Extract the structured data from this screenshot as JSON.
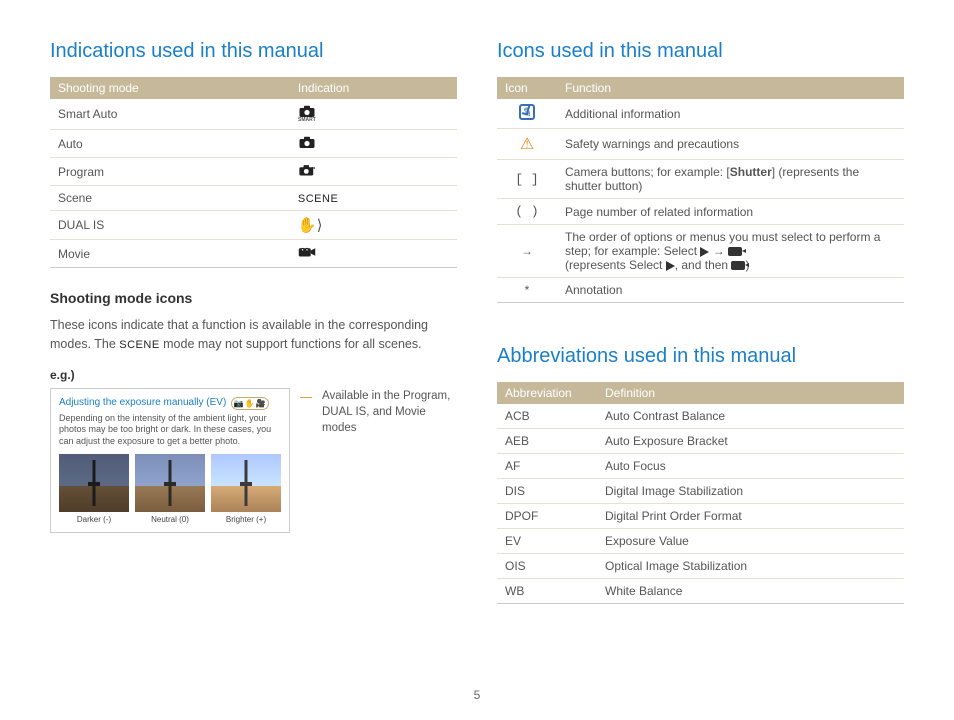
{
  "page_number": "5",
  "left": {
    "heading": "Indications used in this manual",
    "table_headers": {
      "col1": "Shooting mode",
      "col2": "Indication"
    },
    "modes": [
      {
        "name": "Smart Auto",
        "icon": "smart-auto-icon"
      },
      {
        "name": "Auto",
        "icon": "auto-camera-icon"
      },
      {
        "name": "Program",
        "icon": "program-camera-icon"
      },
      {
        "name": "Scene",
        "icon": "scene-icon"
      },
      {
        "name": "DUAL IS",
        "icon": "dual-is-icon"
      },
      {
        "name": "Movie",
        "icon": "movie-icon"
      }
    ],
    "subhead": "Shooting mode icons",
    "body_pre": "These icons indicate that a function is available in the corresponding modes. The ",
    "body_scene": "SCENE",
    "body_post": " mode may not support functions for all scenes.",
    "eg_label": "e.g.)",
    "example": {
      "title": "Adjusting the exposure manually (EV)",
      "desc": "Depending on the intensity of the ambient light, your photos may be too bright or dark. In these cases, you can adjust the exposure to get a better photo.",
      "thumbs": [
        {
          "label": "Darker (-)"
        },
        {
          "label": "Neutral (0)"
        },
        {
          "label": "Brighter (+)"
        }
      ]
    },
    "example_caption": "Available in the Program, DUAL IS, and Movie modes"
  },
  "right": {
    "heading1": "Icons used in this manual",
    "icons_headers": {
      "col1": "Icon",
      "col2": "Function"
    },
    "icons": [
      {
        "sym": "info",
        "func": "Additional information"
      },
      {
        "sym": "warn",
        "func": "Safety warnings and precautions"
      },
      {
        "sym": "[  ]",
        "func_pre": "Camera buttons; for example: [",
        "func_bold": "Shutter",
        "func_post": "] (represents the shutter button)"
      },
      {
        "sym": "(  )",
        "func": "Page number of related information"
      },
      {
        "sym": "→",
        "func_pre": "The order of options or menus you must select to perform a step; for example: Select ",
        "func_mid": " → ",
        "func_post2": "(represents Select ",
        "func_post3": ", and then ",
        "func_post4": ")"
      },
      {
        "sym": "*",
        "func": "Annotation"
      }
    ],
    "heading2": "Abbreviations used in this manual",
    "abbr_headers": {
      "col1": "Abbreviation",
      "col2": "Definition"
    },
    "abbrs": [
      {
        "a": "ACB",
        "d": "Auto Contrast Balance"
      },
      {
        "a": "AEB",
        "d": "Auto Exposure Bracket"
      },
      {
        "a": "AF",
        "d": "Auto Focus"
      },
      {
        "a": "DIS",
        "d": "Digital Image Stabilization"
      },
      {
        "a": "DPOF",
        "d": "Digital Print Order Format"
      },
      {
        "a": "EV",
        "d": "Exposure Value"
      },
      {
        "a": "OIS",
        "d": "Optical Image Stabilization"
      },
      {
        "a": "WB",
        "d": "White Balance"
      }
    ]
  }
}
